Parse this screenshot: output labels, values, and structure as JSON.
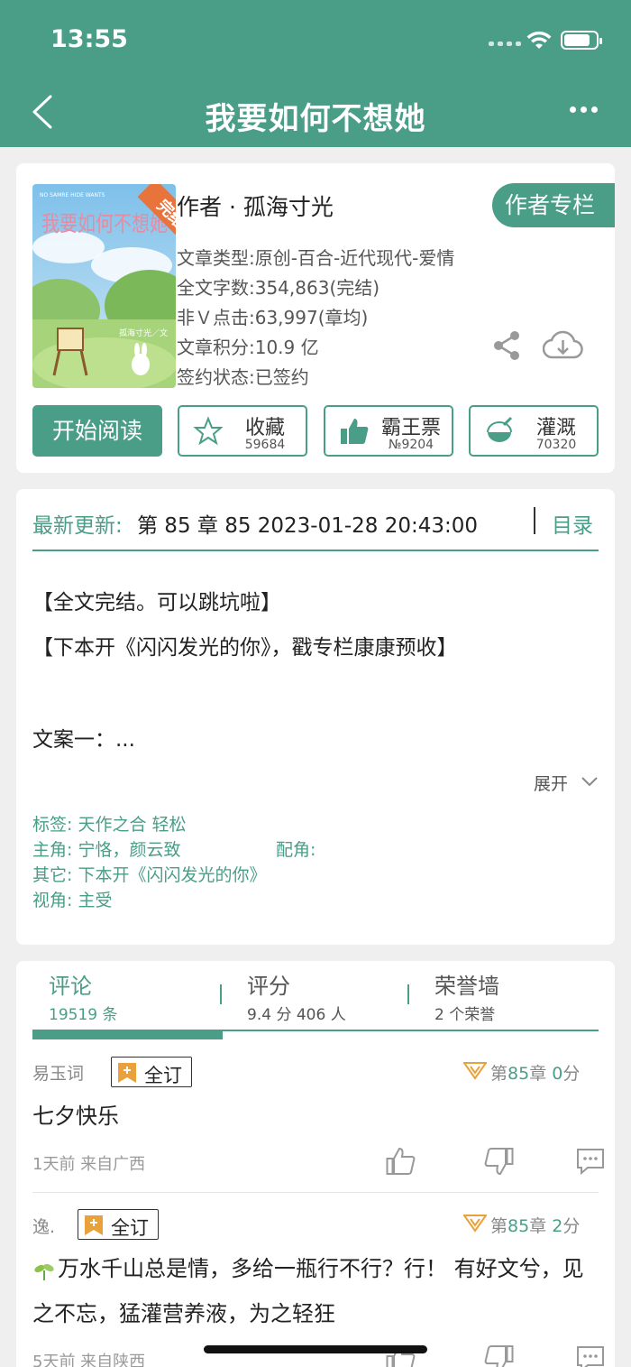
{
  "status_bar": {
    "time": "13:55"
  },
  "nav": {
    "title": "我要如何不想她"
  },
  "book": {
    "cover_title": "我要如何不想她",
    "cover_english": "NO SAMRE HIDE WANTS",
    "cover_byline": "孤海寸光／文",
    "cover_badge": "完结",
    "author": "作者 · 孤海寸光",
    "author_column_button": "作者专栏",
    "meta": [
      "文章类型:原创-百合-近代现代-爱情",
      "全文字数:354,863(完结)",
      "非Ｖ点击:63,997(章均)",
      "文章积分:10.9 亿",
      "签约状态:已签约"
    ],
    "read_button": "开始阅读",
    "actions": [
      {
        "label": "收藏",
        "count": "59684"
      },
      {
        "label": "霸王票",
        "count": "№9204"
      },
      {
        "label": "灌溉",
        "count": "70320"
      }
    ]
  },
  "update": {
    "label": "最新更新:",
    "value": "第 85 章 85 2023-01-28 20:43:00",
    "toc": "目录",
    "desc_lines": [
      "【全文完结。可以跳坑啦】",
      "【下本开《闪闪发光的你》，戳专栏康康预收】",
      "文案一：..."
    ],
    "expand": "展开",
    "tags": "标签:  天作之合   轻松",
    "lead": "主角:  宁恪，颜云致",
    "support": "配角:",
    "other": "其它:  下本开《闪闪发光的你》",
    "pov": "视角:  主受"
  },
  "tabs": [
    {
      "title": "评论",
      "sub": "19519 条"
    },
    {
      "title": "评分",
      "sub": "9.4 分 406 人"
    },
    {
      "title": "荣誉墙",
      "sub": "2 个荣誉"
    }
  ],
  "comments": [
    {
      "user": "易玉词",
      "badge": "全订",
      "ch_prefix": "第",
      "ch_num": "85",
      "ch_mid": "章",
      "score": "0",
      "score_unit": "分",
      "body": "七夕快乐",
      "time": "1天前  来自广西"
    },
    {
      "user": "逸.",
      "badge": "全订",
      "ch_prefix": "第",
      "ch_num": "85",
      "ch_mid": "章",
      "score": "2",
      "score_unit": "分",
      "body": "万水千山总是情，多给一瓶行不行？行！  有好文兮，见之不忘，猛灌营养液，为之轻狂",
      "time": "5天前  来自陕西"
    }
  ],
  "colors": {
    "primary": "#4a9e88",
    "badge_orange": "#e9a23b",
    "cover_ribbon": "#e8733b"
  }
}
